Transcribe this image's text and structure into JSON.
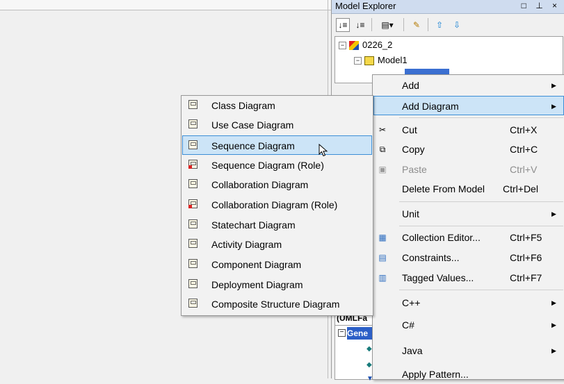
{
  "explorer": {
    "title": "Model Explorer",
    "window_buttons": "□ ⊥ ×",
    "tree": {
      "root": "0226_2",
      "model": "Model1"
    },
    "props_head": "(UMLFa",
    "category": "Gene"
  },
  "context_menu": {
    "items": [
      {
        "label": "Add",
        "has_submenu": true
      },
      {
        "label": "Add Diagram",
        "has_submenu": true,
        "highlighted": true
      },
      {
        "label": "Cut",
        "shortcut": "Ctrl+X",
        "icon": "scissors-icon"
      },
      {
        "label": "Copy",
        "shortcut": "Ctrl+C",
        "icon": "copy-icon"
      },
      {
        "label": "Paste",
        "shortcut": "Ctrl+V",
        "icon": "paste-icon",
        "disabled": true
      },
      {
        "label": "Delete From Model",
        "shortcut": "Ctrl+Del"
      },
      {
        "label": "Unit",
        "has_submenu": true
      },
      {
        "label": "Collection Editor...",
        "shortcut": "Ctrl+F5",
        "icon": "collection-editor-icon"
      },
      {
        "label": "Constraints...",
        "shortcut": "Ctrl+F6",
        "icon": "constraints-icon"
      },
      {
        "label": "Tagged Values...",
        "shortcut": "Ctrl+F7",
        "icon": "tagged-values-icon"
      },
      {
        "label": "C++",
        "has_submenu": true
      },
      {
        "label": "C#",
        "has_submenu": true
      },
      {
        "label": "Java",
        "has_submenu": true
      },
      {
        "label": "Apply Pattern..."
      }
    ]
  },
  "submenu": {
    "items": [
      {
        "label": "Class Diagram"
      },
      {
        "label": "Use Case Diagram"
      },
      {
        "label": "Sequence Diagram",
        "highlighted": true
      },
      {
        "label": "Sequence Diagram (Role)"
      },
      {
        "label": "Collaboration Diagram"
      },
      {
        "label": "Collaboration Diagram (Role)"
      },
      {
        "label": "Statechart Diagram"
      },
      {
        "label": "Activity Diagram"
      },
      {
        "label": "Component Diagram"
      },
      {
        "label": "Deployment Diagram"
      },
      {
        "label": "Composite Structure Diagram"
      }
    ]
  },
  "colors": {
    "highlight_bg": "#cce4f7",
    "highlight_border": "#3c8ed6",
    "selection_blue": "#2c5fc7"
  }
}
